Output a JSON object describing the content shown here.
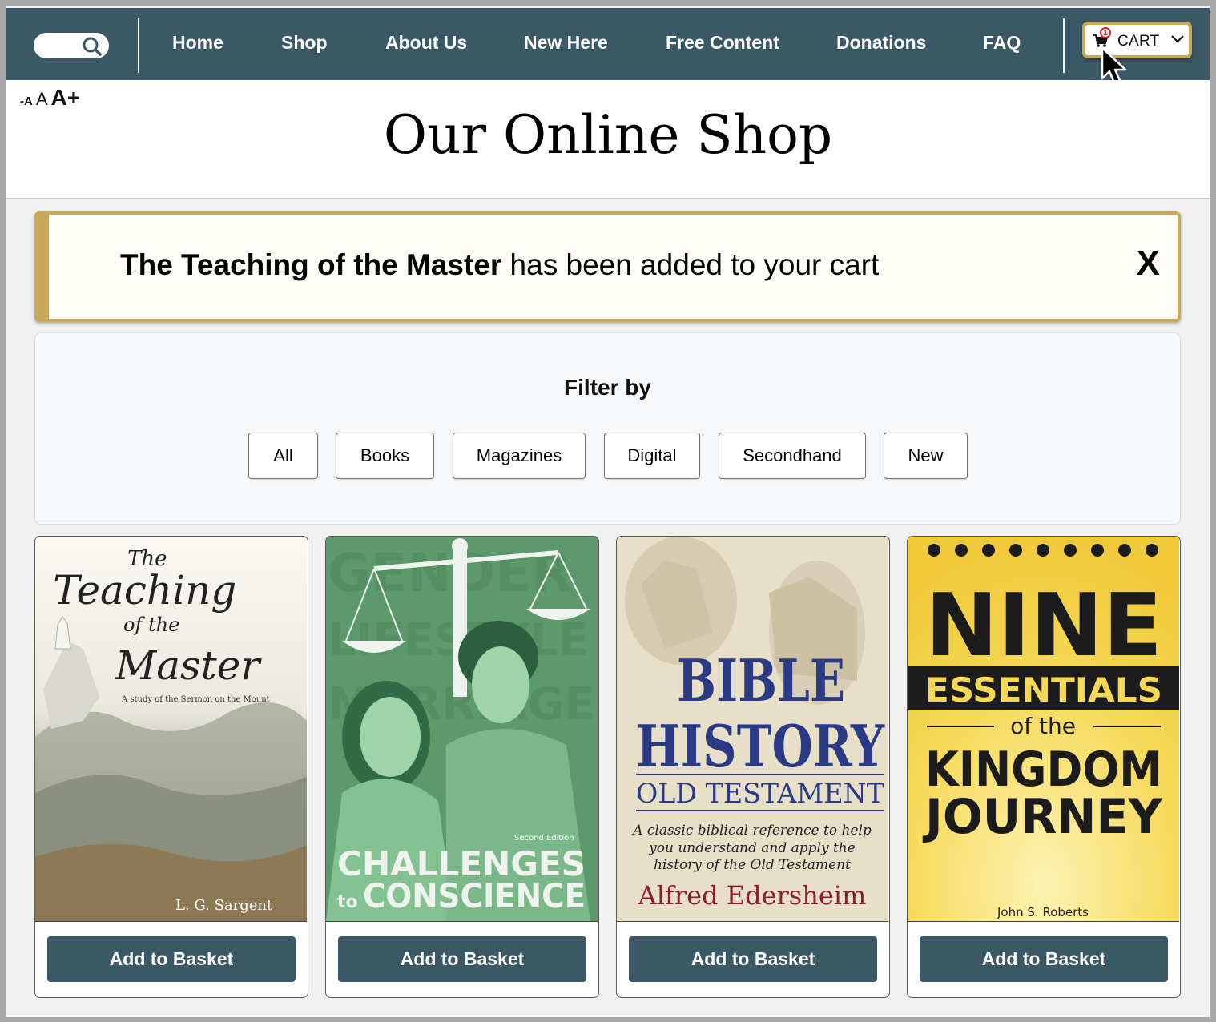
{
  "nav": {
    "search_icon": "search-icon",
    "links": [
      "Home",
      "Shop",
      "About Us",
      "New Here",
      "Free Content",
      "Donations",
      "FAQ"
    ],
    "cart": {
      "label": "CART",
      "count": "1",
      "icon": "cart-icon"
    }
  },
  "font_size_controls": {
    "smaller": "-A",
    "normal": "A",
    "larger": "A+"
  },
  "page_title": "Our Online Shop",
  "notice": {
    "product_name": "The Teaching of the Master",
    "message": " has been added to your cart",
    "close_label": "X"
  },
  "filter": {
    "title": "Filter by",
    "options": [
      "All",
      "Books",
      "Magazines",
      "Digital",
      "Secondhand",
      "New"
    ]
  },
  "products": [
    {
      "button_label": "Add to Basket",
      "cover": {
        "the": "The",
        "teaching": "Teaching",
        "of_the": "of the",
        "master": "Master",
        "subtitle": "A study of the Sermon on the Mount",
        "author": "L. G. Sargent"
      }
    },
    {
      "button_label": "Add to Basket",
      "cover": {
        "bg_word1": "GENDER",
        "bg_word2": "LIFESTYLE",
        "bg_word3": "MARRIAGE",
        "edition": "Second Edition",
        "challenges": "CHALLENGES",
        "to": "to",
        "conscience": "CONSCIENCE"
      }
    },
    {
      "button_label": "Add to Basket",
      "cover": {
        "bible": "BIBLE",
        "history": "HISTORY",
        "old_testament": "OLD TESTAMENT",
        "blurb1": "A classic biblical reference to help",
        "blurb2": "you understand and apply the",
        "blurb3": "history of the Old Testament",
        "author": "Alfred Edersheim"
      }
    },
    {
      "button_label": "Add to Basket",
      "cover": {
        "nine": "NINE",
        "essentials": "ESSENTIALS",
        "of_the": "of the",
        "kingdom": "KINGDOM",
        "journey": "JOURNEY",
        "author": "John S. Roberts"
      }
    }
  ],
  "colors": {
    "nav_bg": "#3a5866",
    "accent_gold": "#c8a95a",
    "button_bg": "#3a5866"
  }
}
